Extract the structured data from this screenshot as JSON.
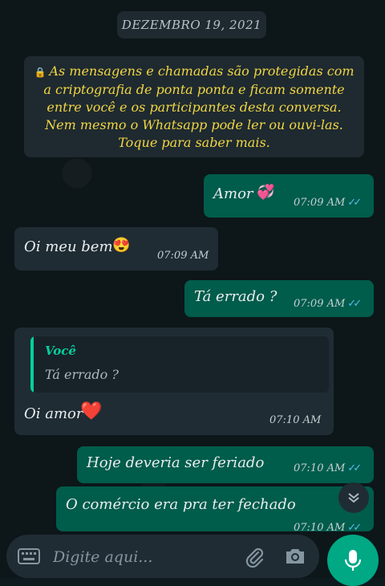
{
  "date_chip": "DEZEMBRO 19, 2021",
  "encryption_notice": "As mensagens e chamadas são protegidas com a criptografia de ponta ponta e ficam somente entre você e os participantes desta conversa. Nem mesmo o Whatsapp pode ler ou ouvi-las. Toque para saber mais.",
  "messages": [
    {
      "direction": "outgoing",
      "text": "Amor",
      "emoji": "💞",
      "time": "07:09 AM",
      "status": "read"
    },
    {
      "direction": "incoming",
      "text": "Oi meu bem",
      "emoji": "😍",
      "time": "07:09 AM"
    },
    {
      "direction": "outgoing",
      "text": "Tá errado ?",
      "time": "07:09 AM",
      "status": "read"
    },
    {
      "direction": "incoming",
      "text": "Oi amor",
      "emoji": "❤️",
      "time": "07:10 AM",
      "reply_to": {
        "author": "Você",
        "text": "Tá errado ?"
      }
    },
    {
      "direction": "outgoing",
      "text": "Hoje deveria ser  feriado",
      "time": "07:10 AM",
      "status": "read"
    },
    {
      "direction": "outgoing",
      "text": "O comércio era pra ter fechado",
      "time": "07:10 AM",
      "status": "read"
    }
  ],
  "input": {
    "placeholder": "Digite aqui..."
  },
  "colors": {
    "outgoing_bubble": "#005c4b",
    "incoming_bubble": "#1f2c34",
    "notice_text": "#f2d544",
    "accent": "#00a884",
    "read_tick": "#53bdeb",
    "quote_accent": "#06cf9c"
  },
  "icons": [
    "lock-icon",
    "double-check-icon",
    "chevron-down-icon",
    "keyboard-icon",
    "paperclip-icon",
    "camera-icon",
    "microphone-icon"
  ]
}
